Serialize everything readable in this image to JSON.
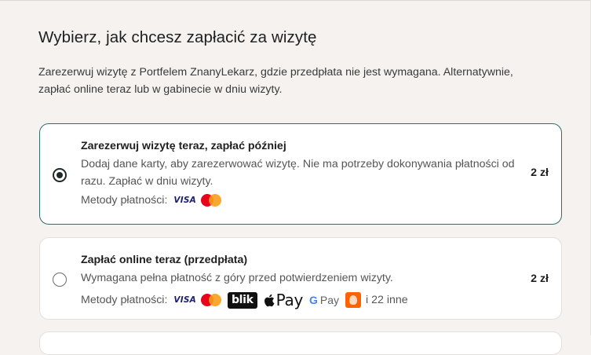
{
  "heading": "Wybierz, jak chcesz zapłacić za wizytę",
  "intro": "Zarezerwuj wizytę z Portfelem ZnanyLekarz, gdzie przedpłata nie jest wymagana. Alternatywnie, zapłać online teraz lub w gabinecie w dniu wizyty.",
  "options": [
    {
      "title": "Zarezerwuj wizytę teraz, zapłać później",
      "description": "Dodaj dane karty, aby zarezerwować wizytę. Nie ma potrzeby dokonywania płatności od razu. Zapłać w dniu wizyty.",
      "methods_label": "Metody płatności:",
      "methods": [
        "visa-icon",
        "mastercard-icon"
      ],
      "price": "2 zł",
      "selected": true
    },
    {
      "title": "Zapłać online teraz (przedpłata)",
      "description": "Wymagana pełna płatność z góry przed potwierdzeniem wizyty.",
      "methods_label": "Metody płatności:",
      "methods": [
        "visa-icon",
        "mastercard-icon",
        "blik-icon",
        "apple-pay-icon",
        "google-pay-icon",
        "ing-icon"
      ],
      "more": "i 22 inne",
      "price": "2 zł",
      "selected": false
    }
  ],
  "logos": {
    "visa": "VISA",
    "blik": "blik",
    "apple_pay": "Pay",
    "google_pay_g": "G",
    "google_pay": "Pay",
    "mastercard": "mastercard"
  },
  "colors": {
    "selected_border": "#2f6f6b",
    "background": "#f5f2ef",
    "visa": "#1a1f71",
    "mastercard_red": "#eb001b",
    "mastercard_orange": "#f79e1b",
    "ing_orange": "#ff6200"
  }
}
